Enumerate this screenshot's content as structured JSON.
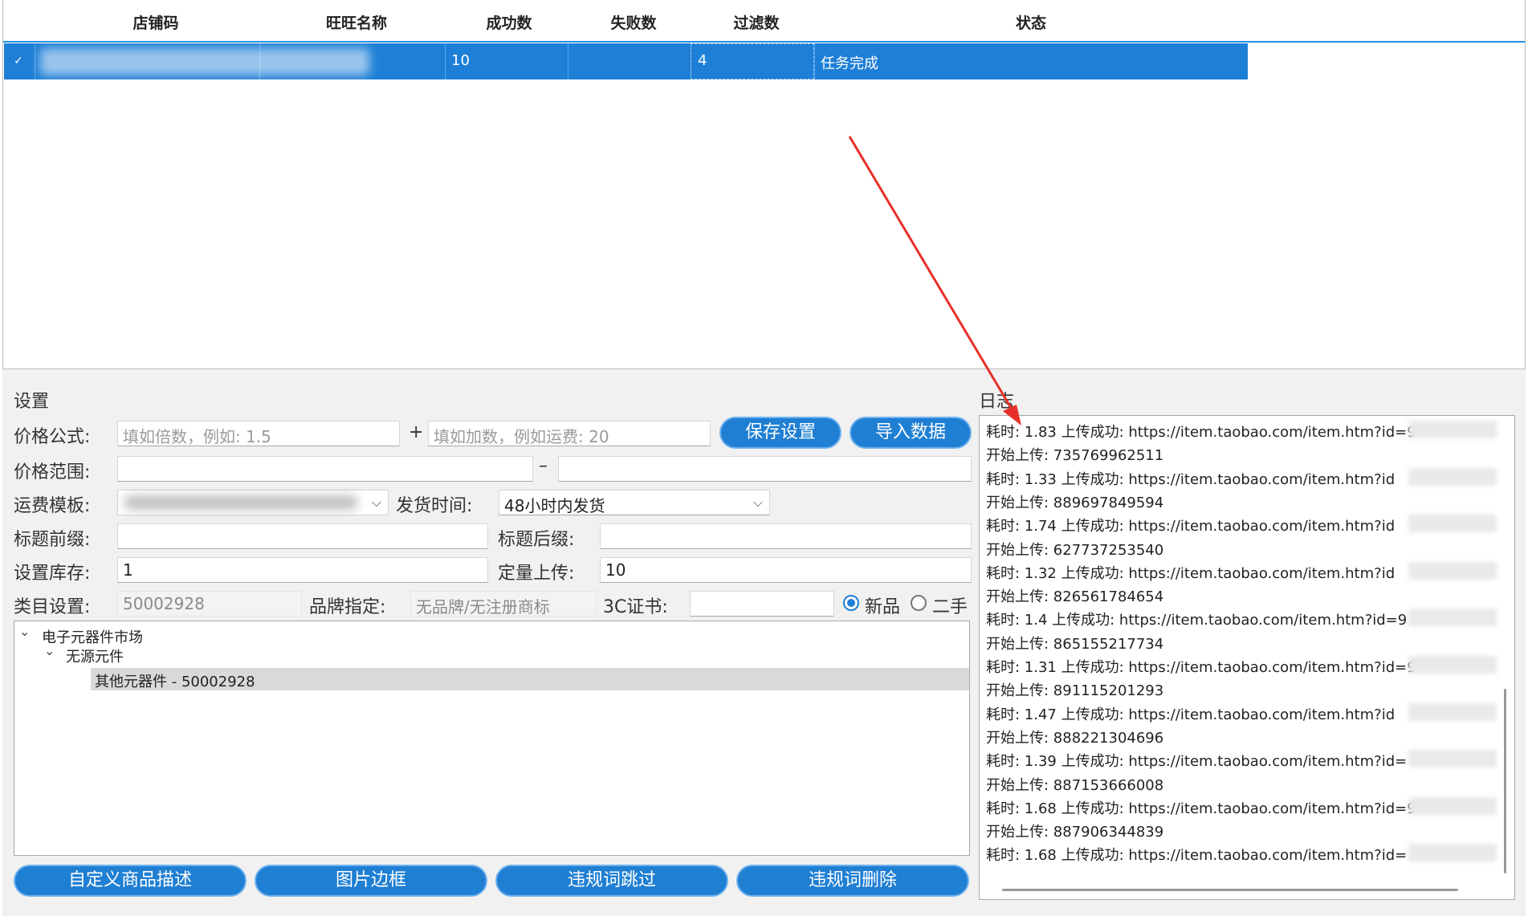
{
  "grid": {
    "columns": [
      "店铺码",
      "旺旺名称",
      "成功数",
      "失败数",
      "过滤数",
      "状态"
    ],
    "rows": [
      {
        "checked": "✓",
        "shop_code": "",
        "wangwang": "",
        "success": "10",
        "failed": "",
        "filtered": "4",
        "status": "任务完成"
      }
    ]
  },
  "settings": {
    "title": "设置",
    "price_formula_label": "价格公式:",
    "price_multiplier_placeholder": "填如倍数，例如: 1.5",
    "plus_sign": "+",
    "price_add_placeholder": "填如加数，例如运费: 20",
    "save_button": "保存设置",
    "import_button": "导入数据",
    "price_range_label": "价格范围:",
    "range_dash": "–",
    "shipping_template_label": "运费模板:",
    "delivery_time_label": "发货时间:",
    "delivery_time_value": "48小时内发货",
    "title_prefix_label": "标题前缀:",
    "title_suffix_label": "标题后缀:",
    "stock_label": "设置库存:",
    "stock_value": "1",
    "quota_label": "定量上传:",
    "quota_value": "10",
    "category_label": "类目设置:",
    "category_value": "50002928",
    "brand_label": "品牌指定:",
    "brand_value": "无品牌/无注册商标",
    "cert_label": "3C证书:",
    "cert_value": "",
    "condition_new": "新品",
    "condition_used": "二手",
    "condition_selected": "新品"
  },
  "tree": {
    "root": "电子元器件市场",
    "child": "无源元件",
    "leaf": "其他元器件 - 50002928"
  },
  "buttons": {
    "custom_desc": "自定义商品描述",
    "image_border": "图片边框",
    "skip_banned": "违规词跳过",
    "delete_banned": "违规词删除"
  },
  "log": {
    "title": "日志",
    "lines": [
      "耗时: 1.83 上传成功: https://item.taobao.com/item.htm?id=9",
      "开始上传: 735769962511",
      "耗时: 1.33 上传成功: https://item.taobao.com/item.htm?id",
      "开始上传: 889697849594",
      "耗时: 1.74 上传成功: https://item.taobao.com/item.htm?id",
      "开始上传: 627737253540",
      "耗时: 1.32 上传成功: https://item.taobao.com/item.htm?id",
      "开始上传: 826561784654",
      "耗时: 1.4 上传成功: https://item.taobao.com/item.htm?id=9",
      "开始上传: 865155217734",
      "耗时: 1.31 上传成功: https://item.taobao.com/item.htm?id=9",
      "开始上传: 891115201293",
      "耗时: 1.47 上传成功: https://item.taobao.com/item.htm?id",
      "开始上传: 888221304696",
      "耗时: 1.39 上传成功: https://item.taobao.com/item.htm?id=",
      "开始上传: 887153666008",
      "耗时: 1.68 上传成功: https://item.taobao.com/item.htm?id=9",
      "开始上传: 887906344839",
      "耗时: 1.68 上传成功: https://item.taobao.com/item.htm?id="
    ]
  },
  "colors": {
    "accent": "#1e7fd6",
    "annotation_arrow": "#e8302a"
  }
}
